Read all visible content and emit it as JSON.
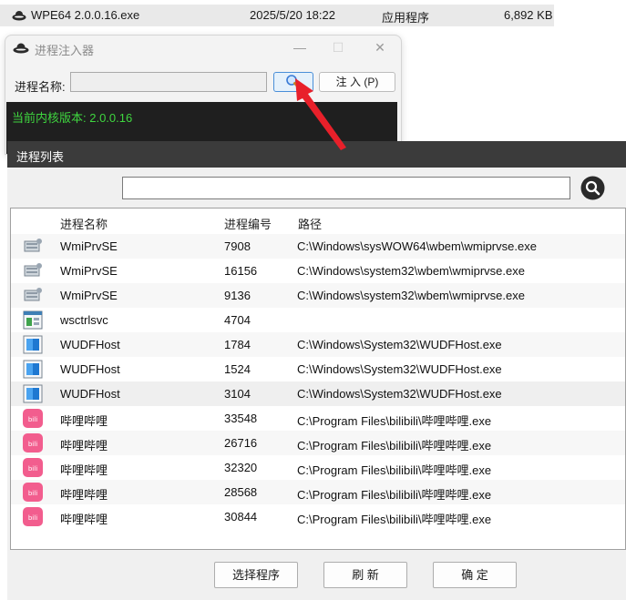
{
  "explorer_row": {
    "filename": "WPE64 2.0.0.16.exe",
    "modified": "2025/5/20 18:22",
    "type": "应用程序",
    "size": "6,892 KB"
  },
  "injector": {
    "title": "进程注入器",
    "caption_buttons": {
      "minimize": "—",
      "maximize": "☐",
      "close": "✕"
    },
    "process_name_label": "进程名称:",
    "process_name_value": "",
    "search_icon": "magnifier-icon",
    "inject_button": "注 入 (P)",
    "console_text": "当前内核版本: 2.0.0.16"
  },
  "process_list": {
    "title": "进程列表",
    "filter_value": "",
    "columns": {
      "name": "进程名称",
      "pid": "进程编号",
      "path": "路径"
    },
    "rows": [
      {
        "icon": "wmi-icon",
        "name": "WmiPrvSE",
        "pid": "7908",
        "path": "C:\\Windows\\sysWOW64\\wbem\\wmiprvse.exe"
      },
      {
        "icon": "wmi-icon",
        "name": "WmiPrvSE",
        "pid": "16156",
        "path": "C:\\Windows\\system32\\wbem\\wmiprvse.exe"
      },
      {
        "icon": "wmi-icon",
        "name": "WmiPrvSE",
        "pid": "9136",
        "path": "C:\\Windows\\system32\\wbem\\wmiprvse.exe"
      },
      {
        "icon": "window-app-icon",
        "name": "wsctrlsvc",
        "pid": "4704",
        "path": ""
      },
      {
        "icon": "wudf-icon",
        "name": "WUDFHost",
        "pid": "1784",
        "path": "C:\\Windows\\System32\\WUDFHost.exe"
      },
      {
        "icon": "wudf-icon",
        "name": "WUDFHost",
        "pid": "1524",
        "path": "C:\\Windows\\System32\\WUDFHost.exe"
      },
      {
        "icon": "wudf-icon",
        "name": "WUDFHost",
        "pid": "3104",
        "path": "C:\\Windows\\System32\\WUDFHost.exe"
      },
      {
        "icon": "bilibili-icon",
        "name": "哔哩哔哩",
        "pid": "33548",
        "path": "C:\\Program Files\\bilibili\\哔哩哔哩.exe"
      },
      {
        "icon": "bilibili-icon",
        "name": "哔哩哔哩",
        "pid": "26716",
        "path": "C:\\Program Files\\bilibili\\哔哩哔哩.exe"
      },
      {
        "icon": "bilibili-icon",
        "name": "哔哩哔哩",
        "pid": "32320",
        "path": "C:\\Program Files\\bilibili\\哔哩哔哩.exe"
      },
      {
        "icon": "bilibili-icon",
        "name": "哔哩哔哩",
        "pid": "28568",
        "path": "C:\\Program Files\\bilibili\\哔哩哔哩.exe"
      },
      {
        "icon": "bilibili-icon",
        "name": "哔哩哔哩",
        "pid": "30844",
        "path": "C:\\Program Files\\bilibili\\哔哩哔哩.exe"
      }
    ],
    "buttons": {
      "select": "选择程序",
      "refresh": "刷 新",
      "ok": "确 定"
    }
  },
  "colors": {
    "console_text": "#3fd63f",
    "arrow": "#e8202a",
    "bilibili": "#f25d8e",
    "title_bar": "#3b3b3b"
  }
}
